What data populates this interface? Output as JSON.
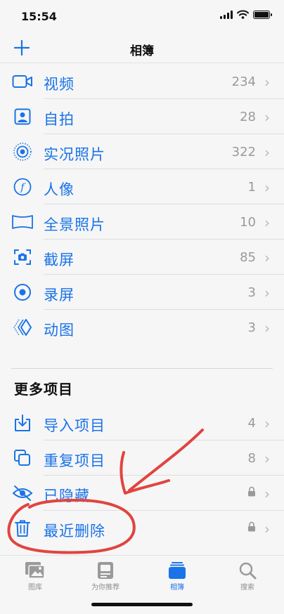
{
  "status_bar": {
    "time": "15:54"
  },
  "nav": {
    "title": "相簿",
    "add_icon": "plus-icon"
  },
  "media_types": [
    {
      "label": "视频",
      "count": "234",
      "icon": "video-icon"
    },
    {
      "label": "自拍",
      "count": "28",
      "icon": "selfie-icon"
    },
    {
      "label": "实况照片",
      "count": "322",
      "icon": "live-photo-icon"
    },
    {
      "label": "人像",
      "count": "1",
      "icon": "portrait-icon"
    },
    {
      "label": "全景照片",
      "count": "10",
      "icon": "panorama-icon"
    },
    {
      "label": "截屏",
      "count": "85",
      "icon": "screenshot-icon"
    },
    {
      "label": "录屏",
      "count": "3",
      "icon": "screen-recording-icon"
    },
    {
      "label": "动图",
      "count": "3",
      "icon": "animated-icon"
    }
  ],
  "more_items": {
    "title": "更多项目",
    "items": [
      {
        "label": "导入项目",
        "count": "4",
        "icon": "import-icon"
      },
      {
        "label": "重复项目",
        "count": "8",
        "icon": "duplicates-icon"
      },
      {
        "label": "已隐藏",
        "locked": true,
        "icon": "hidden-eye-icon"
      },
      {
        "label": "最近删除",
        "locked": true,
        "icon": "trash-icon"
      }
    ]
  },
  "tabs": [
    {
      "label": "图库",
      "icon": "library-icon",
      "active": false
    },
    {
      "label": "为你推荐",
      "icon": "for-you-icon",
      "active": false
    },
    {
      "label": "相簿",
      "icon": "albums-icon",
      "active": true
    },
    {
      "label": "搜索",
      "icon": "search-icon",
      "active": false
    }
  ],
  "colors": {
    "accent": "#1a73e8",
    "annotation": "#e0453f",
    "secondary_text": "#9a9a9a"
  }
}
